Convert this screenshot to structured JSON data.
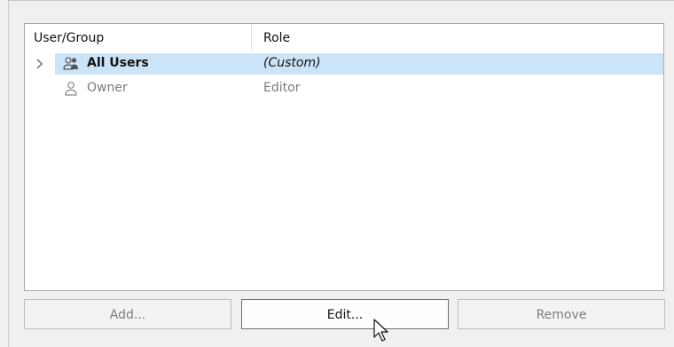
{
  "table": {
    "columns": {
      "user_group": "User/Group",
      "role": "Role"
    },
    "rows": [
      {
        "name": "All Users",
        "role": "(Custom)",
        "icon": "group-icon",
        "selected": true
      },
      {
        "name": "Owner",
        "role": "Editor",
        "icon": "user-icon",
        "selected": false
      }
    ]
  },
  "buttons": {
    "add_label": "Add...",
    "edit_label": "Edit...",
    "remove_label": "Remove"
  },
  "colors": {
    "selection": "#cce4f7",
    "border": "#a9a9a9",
    "dim_text": "#7a7a7a"
  }
}
